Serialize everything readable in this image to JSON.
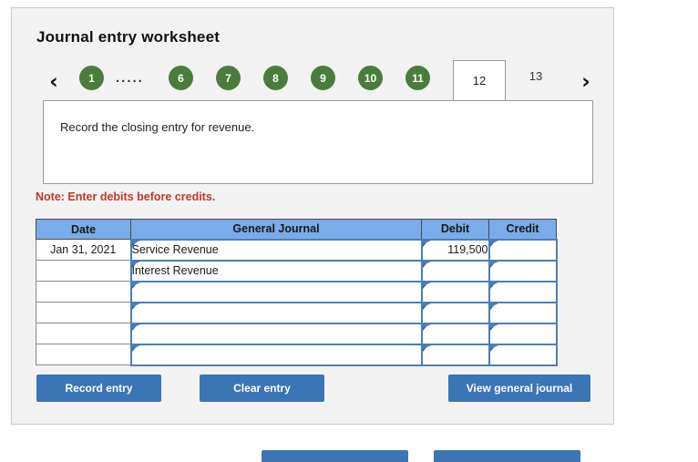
{
  "panel": {
    "title": "Journal entry worksheet"
  },
  "pager": {
    "prev_icon": "‹",
    "next_icon": "›",
    "dots": ".....",
    "circles": [
      "1",
      "6",
      "7",
      "8",
      "9",
      "10",
      "11"
    ],
    "active": "12",
    "plain": "13"
  },
  "instruction": {
    "text": "Record the closing entry for revenue."
  },
  "note": {
    "text": "Note: Enter debits before credits."
  },
  "table": {
    "headers": {
      "date": "Date",
      "general_journal": "General Journal",
      "debit": "Debit",
      "credit": "Credit"
    },
    "rows": [
      {
        "date": "Jan 31, 2021",
        "account": "Service Revenue",
        "debit": "119,500",
        "credit": ""
      },
      {
        "date": "",
        "account": "Interest Revenue",
        "debit": "",
        "credit": ""
      },
      {
        "date": "",
        "account": "",
        "debit": "",
        "credit": ""
      },
      {
        "date": "",
        "account": "",
        "debit": "",
        "credit": ""
      },
      {
        "date": "",
        "account": "",
        "debit": "",
        "credit": ""
      },
      {
        "date": "",
        "account": "",
        "debit": "",
        "credit": ""
      }
    ]
  },
  "buttons": {
    "record": "Record entry",
    "clear": "Clear entry",
    "view": "View general journal"
  },
  "colors": {
    "tab_green": "#4a7c3c",
    "header_blue": "#79ace8",
    "button_blue": "#3b75b5",
    "note_red": "#c0392b",
    "cell_border_blue": "#4a7ebb",
    "panel_bg": "#f2f2f2"
  }
}
